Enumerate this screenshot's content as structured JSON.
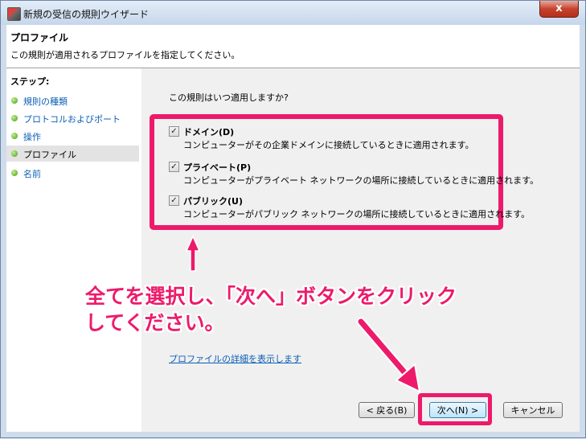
{
  "window": {
    "title": "新規の受信の規則ウイザード",
    "close_label": "x"
  },
  "header": {
    "title": "プロファイル",
    "description": "この規則が適用されるプロファイルを指定してください。"
  },
  "steps": {
    "label": "ステップ:",
    "items": [
      {
        "label": "規則の種類",
        "current": false
      },
      {
        "label": "プロトコルおよびポート",
        "current": false
      },
      {
        "label": "操作",
        "current": false
      },
      {
        "label": "プロファイル",
        "current": true
      },
      {
        "label": "名前",
        "current": false
      }
    ]
  },
  "main": {
    "question": "この規則はいつ適用しますか?",
    "options": [
      {
        "title": "ドメイン(D)",
        "description": "コンピューターがその企業ドメインに接続しているときに適用されます。",
        "checked": true
      },
      {
        "title": "プライベート(P)",
        "description": "コンピューターがプライベート ネットワークの場所に接続しているときに適用されます。",
        "checked": true
      },
      {
        "title": "パブリック(U)",
        "description": "コンピューターがパブリック ネットワークの場所に接続しているときに適用されます。",
        "checked": true
      }
    ],
    "details_link": "プロファイルの詳細を表示します"
  },
  "buttons": {
    "back": "< 戻る(B)",
    "next": "次へ(N) >",
    "cancel": "キャンセル"
  },
  "annotation": {
    "line1": "全てを選択し、「次へ」ボタンをクリック",
    "line2": "してください。",
    "color": "#ed1a6b"
  },
  "checkmark": "✓"
}
